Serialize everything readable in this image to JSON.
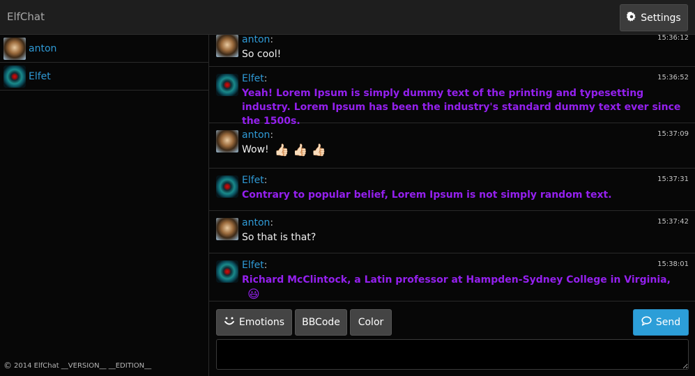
{
  "app": {
    "title": "ElfChat"
  },
  "toolbar": {
    "settings_label": "Settings"
  },
  "users": [
    {
      "name": "anton",
      "avatar": "tiger-avatar"
    },
    {
      "name": "Elfet",
      "avatar": "eye-avatar"
    }
  ],
  "footer": {
    "copyright_symbol": "©",
    "text": "2014 ElfChat __VERSION__ __EDITION__"
  },
  "messages": [
    {
      "author": "anton",
      "time": "15:36:12",
      "text": "So cool!",
      "style": "white"
    },
    {
      "author": "Elfet",
      "time": "15:36:52",
      "text": "Yeah! Lorem Ipsum is simply dummy text of the printing and typesetting industry. Lorem Ipsum has been the industry's standard dummy text ever since the 1500s.",
      "style": "purple"
    },
    {
      "author": "anton",
      "time": "15:37:09",
      "text": "Wow!",
      "style": "white",
      "emoji": "👍🏻 👍🏻 👍🏻"
    },
    {
      "author": "Elfet",
      "time": "15:37:31",
      "text": "Contrary to popular belief, Lorem Ipsum is not simply random text.",
      "style": "purple"
    },
    {
      "author": "anton",
      "time": "15:37:42",
      "text": "So that is that?",
      "style": "white"
    },
    {
      "author": "Elfet",
      "time": "15:38:01",
      "text": "Richard McClintock, a Latin professor at Hampden-Sydney College in Virginia,",
      "style": "purple",
      "emoji": "😃"
    }
  ],
  "input_bar": {
    "emotions_label": "Emotions",
    "bbcode_label": "BBCode",
    "color_label": "Color",
    "send_label": "Send",
    "message_value": ""
  },
  "colors": {
    "link_blue": "#2f9ad6",
    "purple_text": "#9420ee",
    "send_blue": "#2c9ed8"
  }
}
